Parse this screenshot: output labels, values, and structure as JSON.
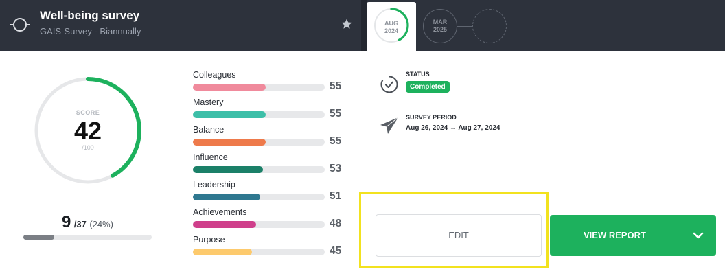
{
  "header": {
    "title": "Well-being survey",
    "subtitle": "GAIS-Survey - Biannually",
    "icons": {
      "survey": "survey-cycle-icon",
      "favorite": "star-icon"
    }
  },
  "timeline": {
    "active": {
      "month": "AUG",
      "year": "2024",
      "progress": 0.42
    },
    "next": {
      "month": "MAR",
      "year": "2025"
    },
    "placeholder": "empty-survey-slot"
  },
  "score": {
    "label": "SCORE",
    "value": "42",
    "max": "/100",
    "fraction": 0.42,
    "color": "#1db15d"
  },
  "responses": {
    "count": "9",
    "total": "/37",
    "percent": "(24%)",
    "fraction": 0.24
  },
  "dimensions": [
    {
      "name": "Colleagues",
      "value": "55",
      "fraction": 0.55,
      "color": "#f08a9c"
    },
    {
      "name": "Mastery",
      "value": "55",
      "fraction": 0.55,
      "color": "#3dbfa8"
    },
    {
      "name": "Balance",
      "value": "55",
      "fraction": 0.55,
      "color": "#ee7a4b"
    },
    {
      "name": "Influence",
      "value": "53",
      "fraction": 0.53,
      "color": "#1b8068"
    },
    {
      "name": "Leadership",
      "value": "51",
      "fraction": 0.51,
      "color": "#2f7890"
    },
    {
      "name": "Achievements",
      "value": "48",
      "fraction": 0.48,
      "color": "#cf3f8b"
    },
    {
      "name": "Purpose",
      "value": "45",
      "fraction": 0.45,
      "color": "#fdca6d"
    }
  ],
  "status": {
    "label": "STATUS",
    "value": "Completed",
    "color": "#1db15d",
    "icon": "check-circle-icon"
  },
  "period": {
    "label": "SURVEY PERIOD",
    "value": "Aug 26, 2024 → Aug 27, 2024",
    "icon": "paper-plane-icon"
  },
  "actions": {
    "edit_label": "EDIT",
    "view_report_label": "VIEW REPORT",
    "dropdown_icon": "chevron-down-icon",
    "highlight_color": "#f2e21f"
  }
}
